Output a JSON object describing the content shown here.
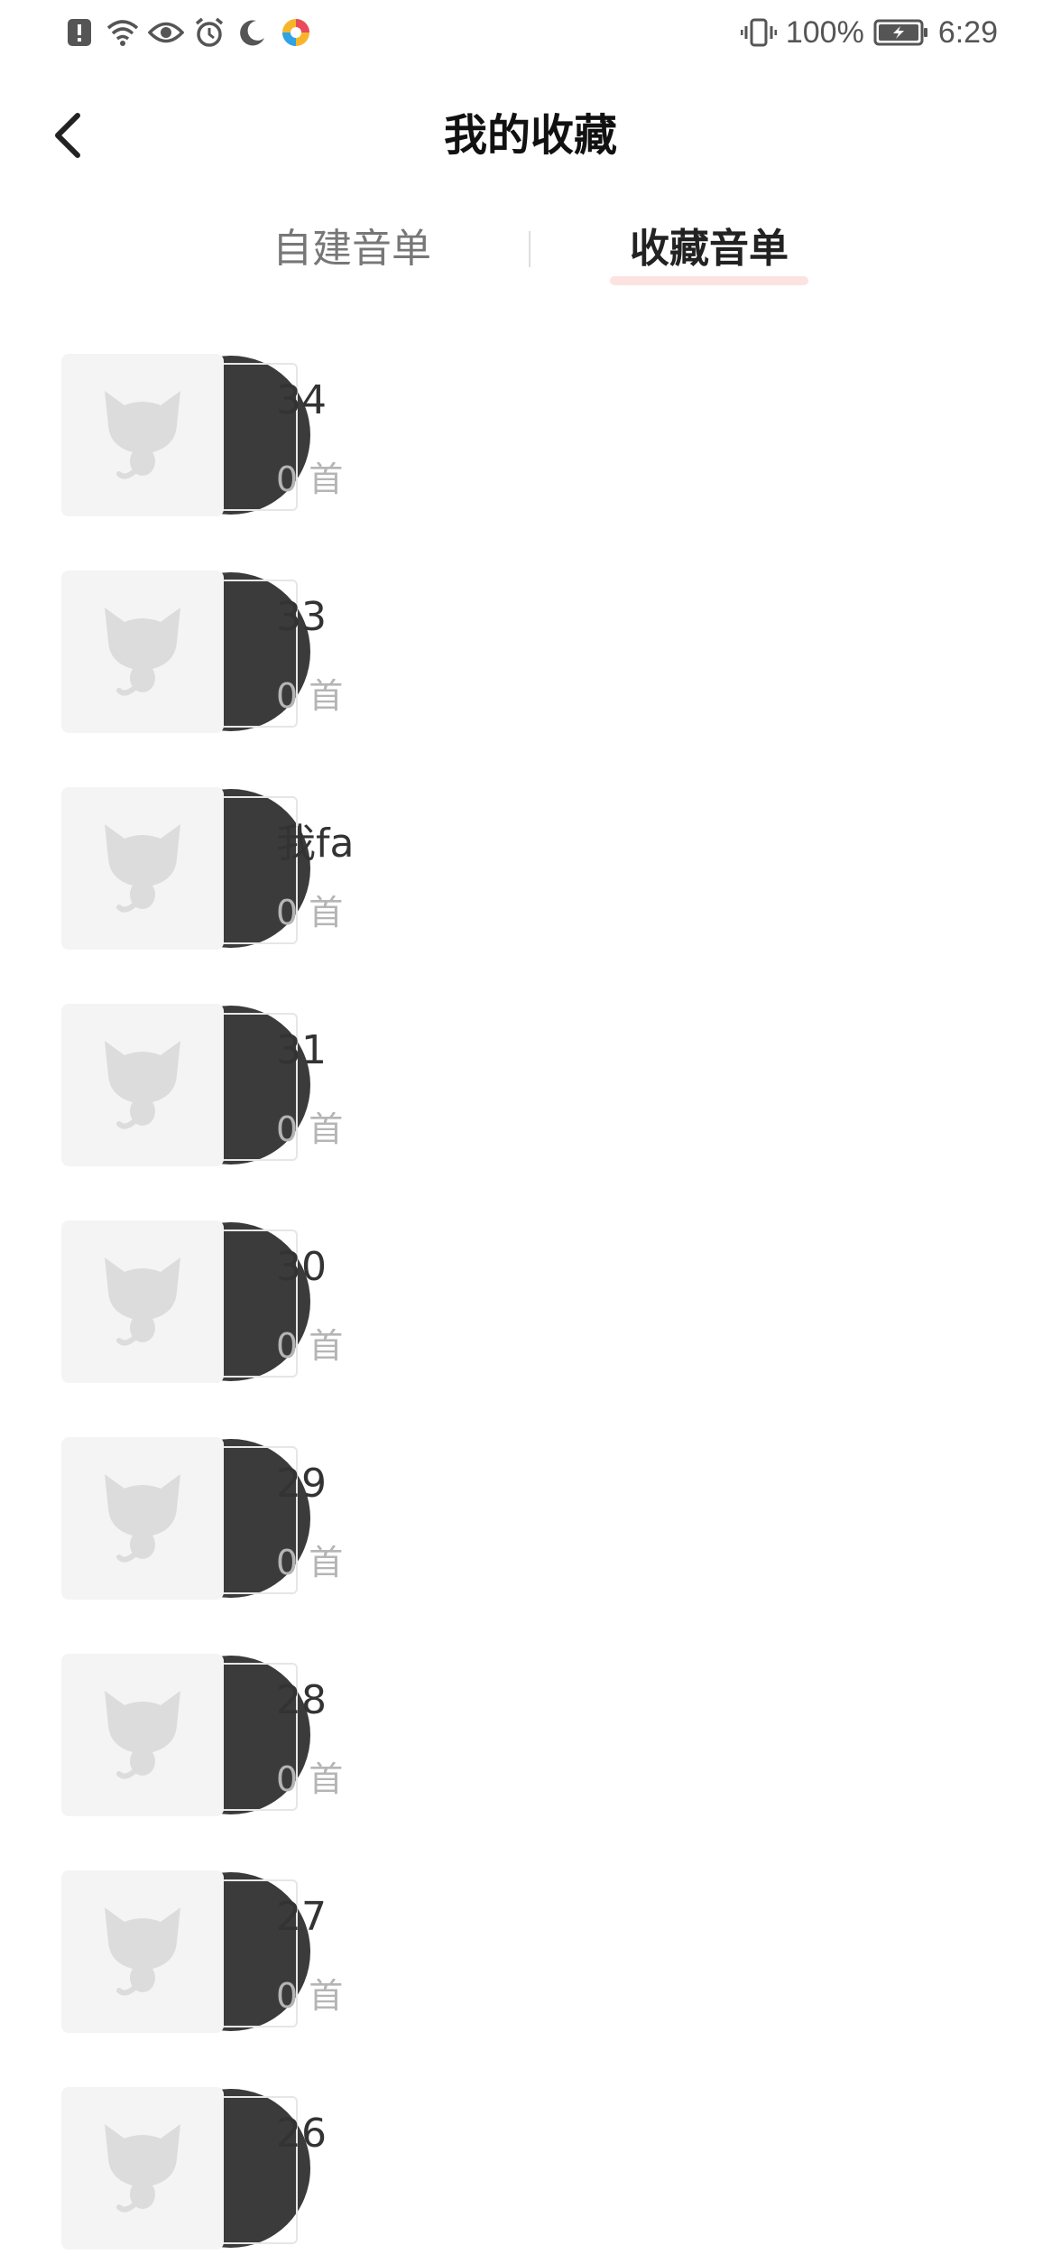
{
  "status_bar": {
    "battery_percent": "100%",
    "time": "6:29",
    "icons": [
      "alert-icon",
      "wifi-icon",
      "eye-icon",
      "alarm-icon",
      "moon-icon",
      "app-logo-icon",
      "vibrate-icon",
      "battery-charging-icon"
    ]
  },
  "header": {
    "title": "我的收藏",
    "back_icon": "chevron-left-icon"
  },
  "tabs": [
    {
      "label": "自建音单",
      "active": false
    },
    {
      "label": "收藏音单",
      "active": true
    }
  ],
  "colors": {
    "active_tab_underline": "#fde2e2",
    "cover_placeholder": "#f4f4f4",
    "vinyl": "#3b3b3b",
    "count_text": "#b5b5b5"
  },
  "playlists": [
    {
      "name": "34",
      "count": "0 首"
    },
    {
      "name": "33",
      "count": "0 首"
    },
    {
      "name": "我fa",
      "count": "0 首"
    },
    {
      "name": "31",
      "count": "0 首"
    },
    {
      "name": "30",
      "count": "0 首"
    },
    {
      "name": "29",
      "count": "0 首"
    },
    {
      "name": "28",
      "count": "0 首"
    },
    {
      "name": "27",
      "count": "0 首"
    },
    {
      "name": "26",
      "count": ""
    }
  ]
}
